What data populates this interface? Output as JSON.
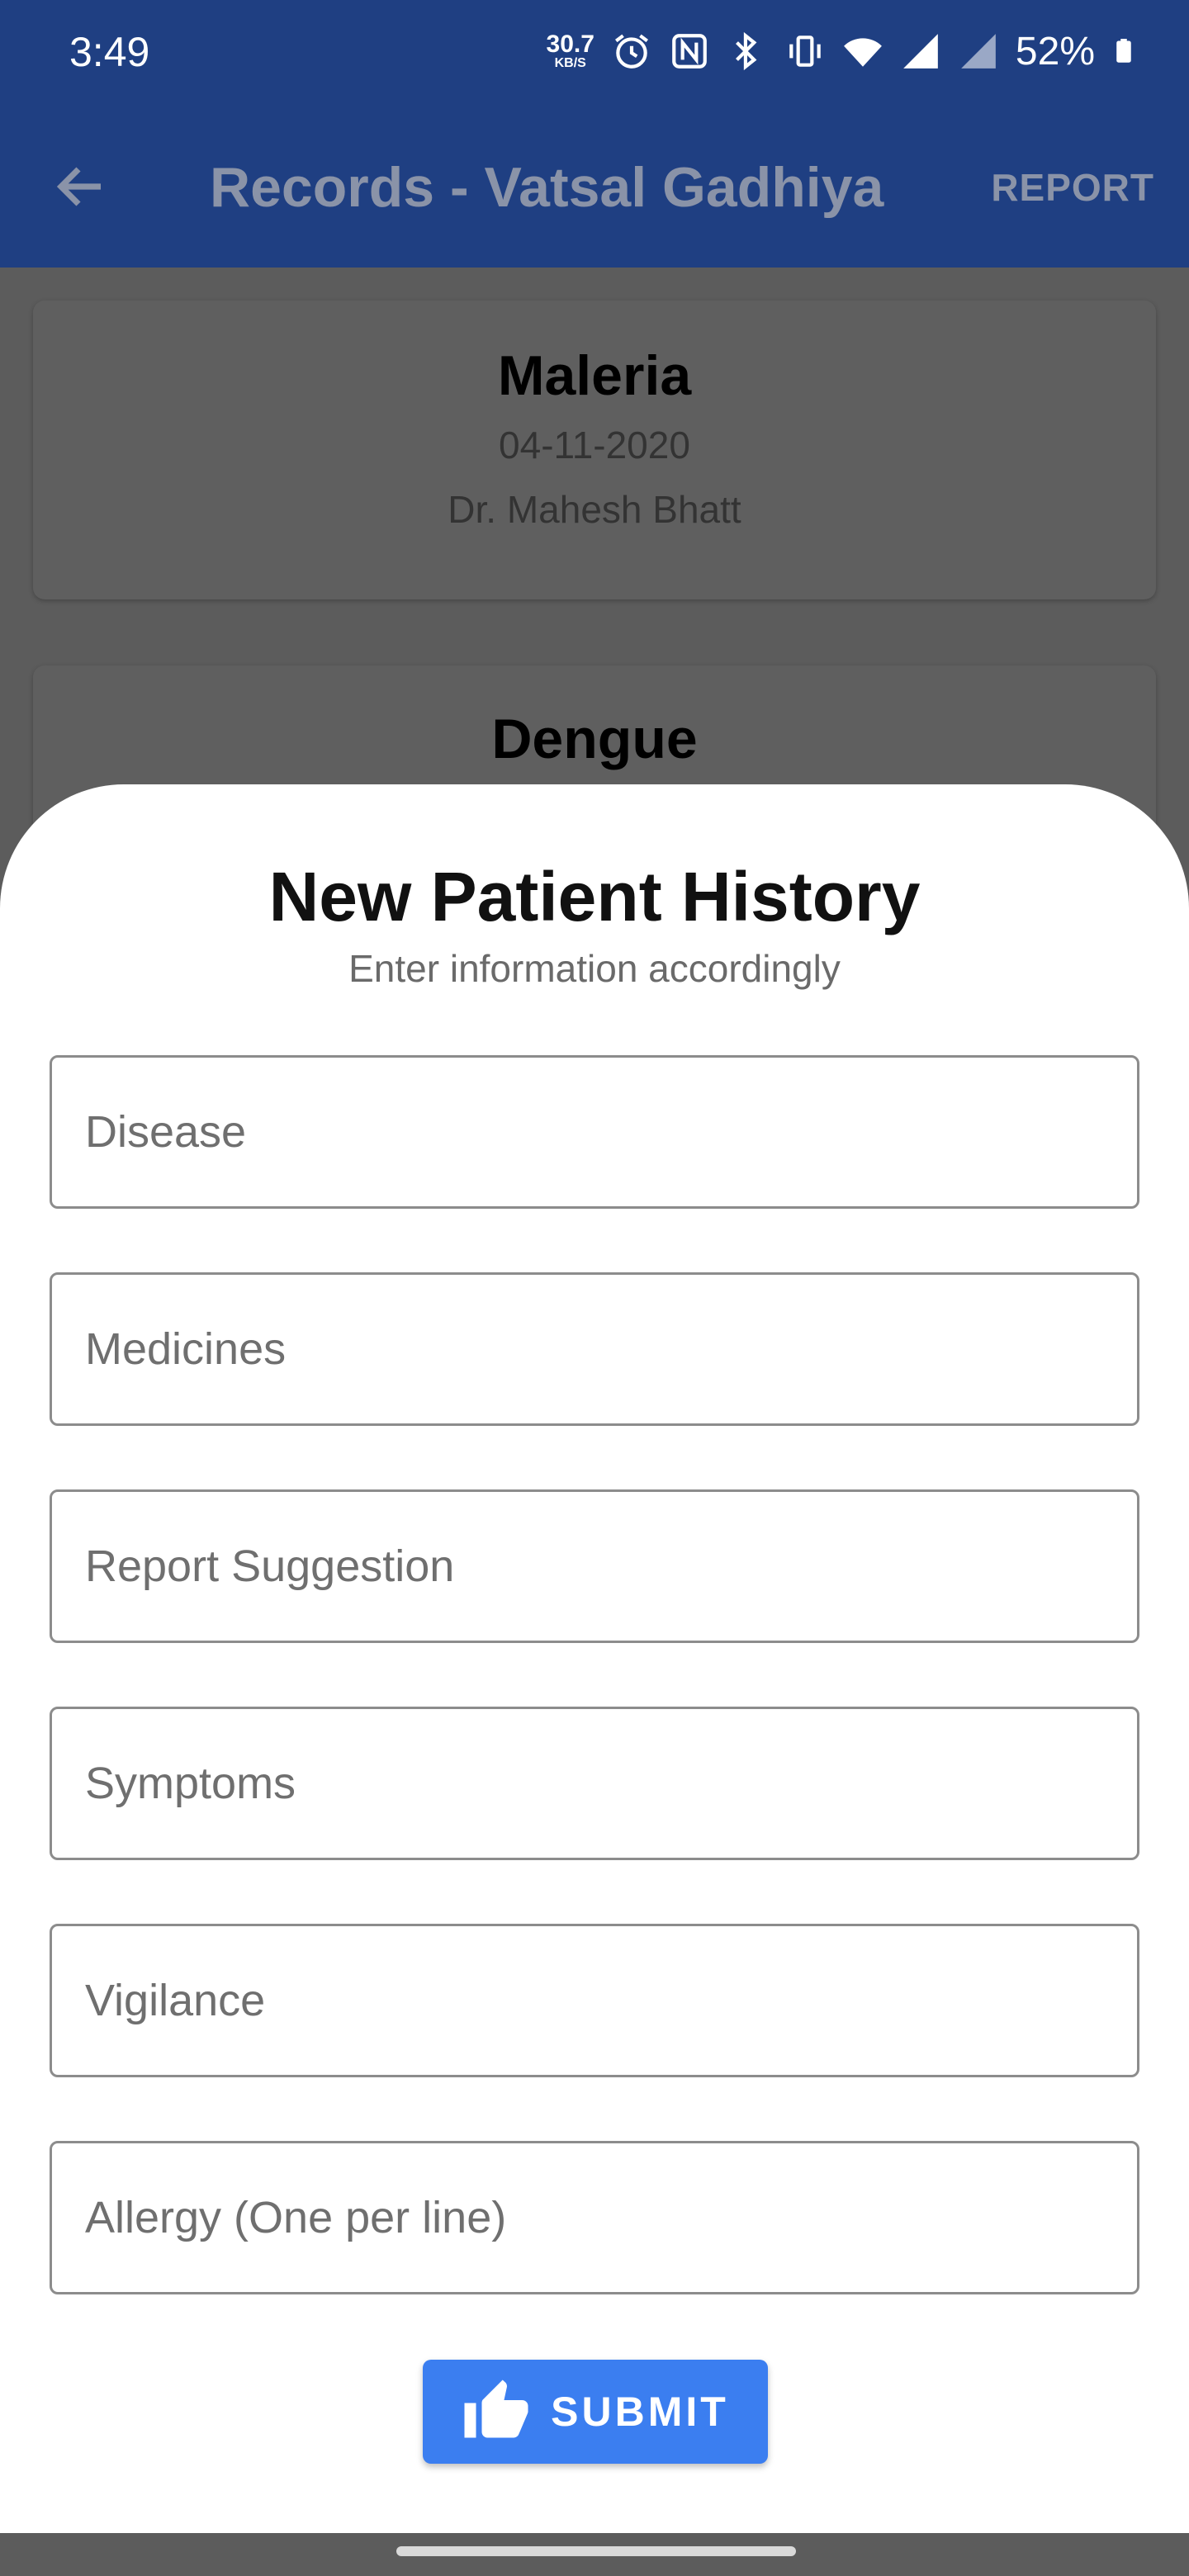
{
  "status_bar": {
    "time": "3:49",
    "net_speed_value": "30.7",
    "net_speed_unit": "KB/S",
    "battery": "52%",
    "icons": [
      "alarm-icon",
      "nfc-icon",
      "bluetooth-icon",
      "vibrate-icon",
      "wifi-icon",
      "signal-icon",
      "signal-icon",
      "battery-icon"
    ]
  },
  "app_bar": {
    "title": "Records - Vatsal Gadhiya",
    "action": "REPORT",
    "color": "#1f3f82"
  },
  "records": [
    {
      "disease": "Maleria",
      "date": "04-11-2020",
      "doctor": "Dr. Mahesh Bhatt"
    },
    {
      "disease": "Dengue"
    }
  ],
  "sheet": {
    "title": "New Patient History",
    "subtitle": "Enter information accordingly",
    "fields": [
      {
        "placeholder": "Disease",
        "value": ""
      },
      {
        "placeholder": "Medicines",
        "value": ""
      },
      {
        "placeholder": "Report Suggestion",
        "value": ""
      },
      {
        "placeholder": "Symptoms",
        "value": ""
      },
      {
        "placeholder": "Vigilance",
        "value": ""
      },
      {
        "placeholder": "Allergy (One per line)",
        "value": ""
      }
    ],
    "submit_label": "SUBMIT",
    "submit_color": "#3b7ef0"
  }
}
